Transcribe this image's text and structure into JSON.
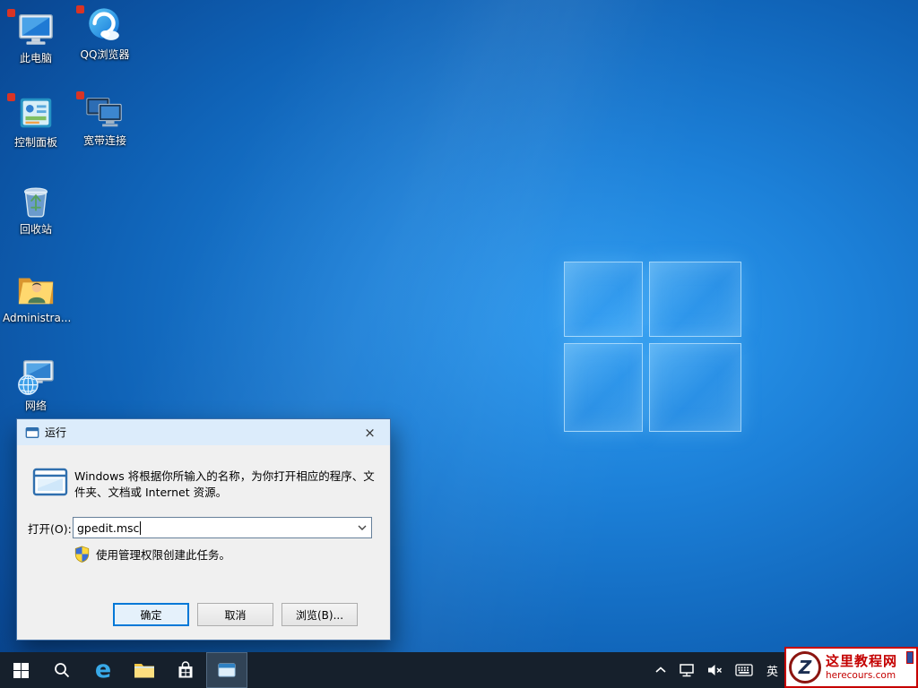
{
  "desktop": {
    "icons": [
      {
        "label": "此电脑"
      },
      {
        "label": "QQ浏览器"
      },
      {
        "label": "控制面板"
      },
      {
        "label": "宽带连接"
      },
      {
        "label": "回收站"
      },
      {
        "label": "Administra..."
      },
      {
        "label": "网络"
      }
    ]
  },
  "run_dialog": {
    "title": "运行",
    "close_glyph": "×",
    "description": "Windows 将根据你所输入的名称，为你打开相应的程序、文件夹、文档或 Internet 资源。",
    "open_label": "打开(O):",
    "input_value": "gpedit.msc",
    "admin_note": "使用管理权限创建此任务。",
    "ok_label": "确定",
    "cancel_label": "取消",
    "browse_label": "浏览(B)..."
  },
  "taskbar": {
    "edge_glyph": "e",
    "ime_label": "英"
  },
  "watermark": {
    "logo_letter": "Z",
    "title": "这里教程网",
    "url": "herecours.com"
  },
  "colors": {
    "accent": "#0078d7",
    "taskbar": "#16202c",
    "dialog_titlebar": "#dcecfb",
    "watermark_red": "#c60000",
    "wallpaper_center": "#2e9cf1"
  }
}
